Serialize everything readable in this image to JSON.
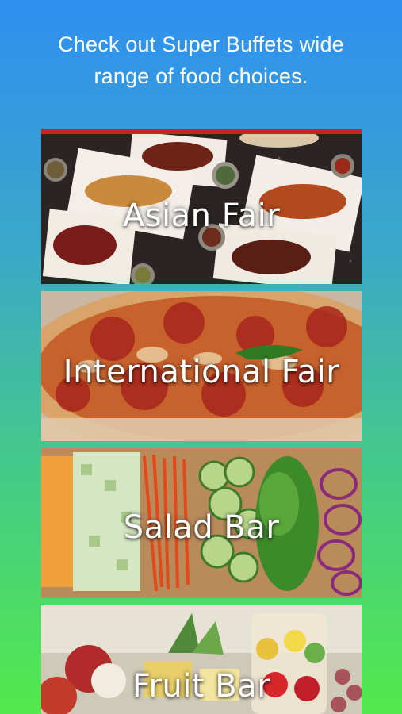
{
  "header": {
    "line1": "Check out Super Buffets wide",
    "line2": "range of food choices."
  },
  "categories": [
    {
      "label": "Asian Fair",
      "image": "asian-food-photo"
    },
    {
      "label": "International Fair",
      "image": "pizza-photo"
    },
    {
      "label": "Salad Bar",
      "image": "vegetables-photo"
    },
    {
      "label": "Fruit Bar",
      "image": "fruit-photo"
    }
  ],
  "colors": {
    "gradient_top": "#2f8ff0",
    "gradient_bottom": "#55e84c",
    "accent": "#c8252a"
  }
}
